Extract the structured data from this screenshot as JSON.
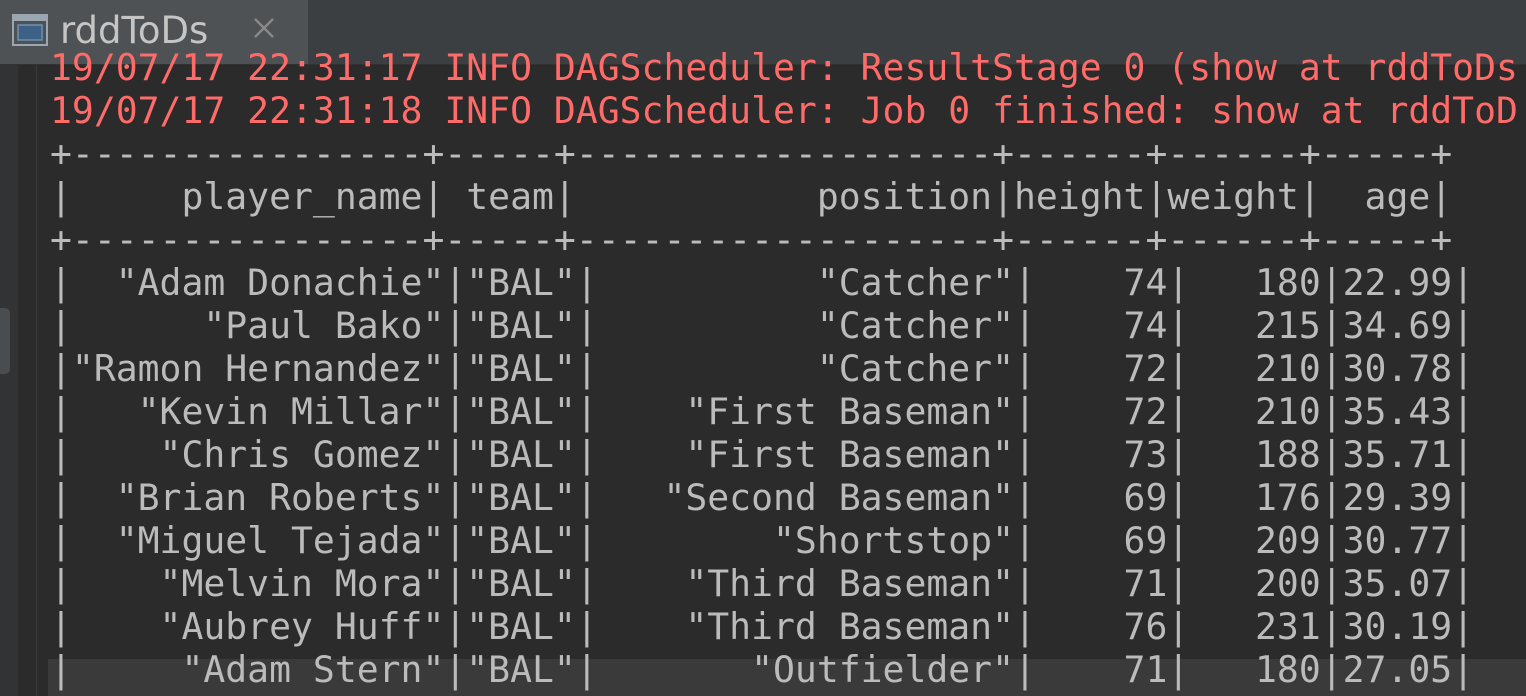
{
  "tab": {
    "title": "rddToDs",
    "icon": "console-icon",
    "close_icon": "close-icon"
  },
  "colors": {
    "log_text": "#ff6b68",
    "output_text": "#bbbbbb",
    "background": "#2b2b2b"
  },
  "console": {
    "log_lines": [
      "19/07/17 22:31:17 INFO DAGScheduler: ResultStage 0 (show at rddToDs",
      "19/07/17 22:31:18 INFO DAGScheduler: Job 0 finished: show at rddToD"
    ],
    "table": {
      "border": "+----------------+-----+-------------------+------+------+-----+",
      "header": "|     player_name| team|           position|height|weight|  age|",
      "rows": [
        "|  \"Adam Donachie\"|\"BAL\"|          \"Catcher\"|    74|   180|22.99|",
        "|      \"Paul Bako\"|\"BAL\"|          \"Catcher\"|    74|   215|34.69|",
        "|\"Ramon Hernandez\"|\"BAL\"|          \"Catcher\"|    72|   210|30.78|",
        "|   \"Kevin Millar\"|\"BAL\"|    \"First Baseman\"|    72|   210|35.43|",
        "|    \"Chris Gomez\"|\"BAL\"|    \"First Baseman\"|    73|   188|35.71|",
        "|  \"Brian Roberts\"|\"BAL\"|   \"Second Baseman\"|    69|   176|29.39|",
        "|  \"Miguel Tejada\"|\"BAL\"|        \"Shortstop\"|    69|   209|30.77|",
        "|    \"Melvin Mora\"|\"BAL\"|    \"Third Baseman\"|    71|   200|35.07|",
        "|    \"Aubrey Huff\"|\"BAL\"|    \"Third Baseman\"|    76|   231|30.19|",
        "|     \"Adam Stern\"|\"BAL\"|       \"Outfielder\"|    71|   180|27.05|"
      ]
    }
  }
}
